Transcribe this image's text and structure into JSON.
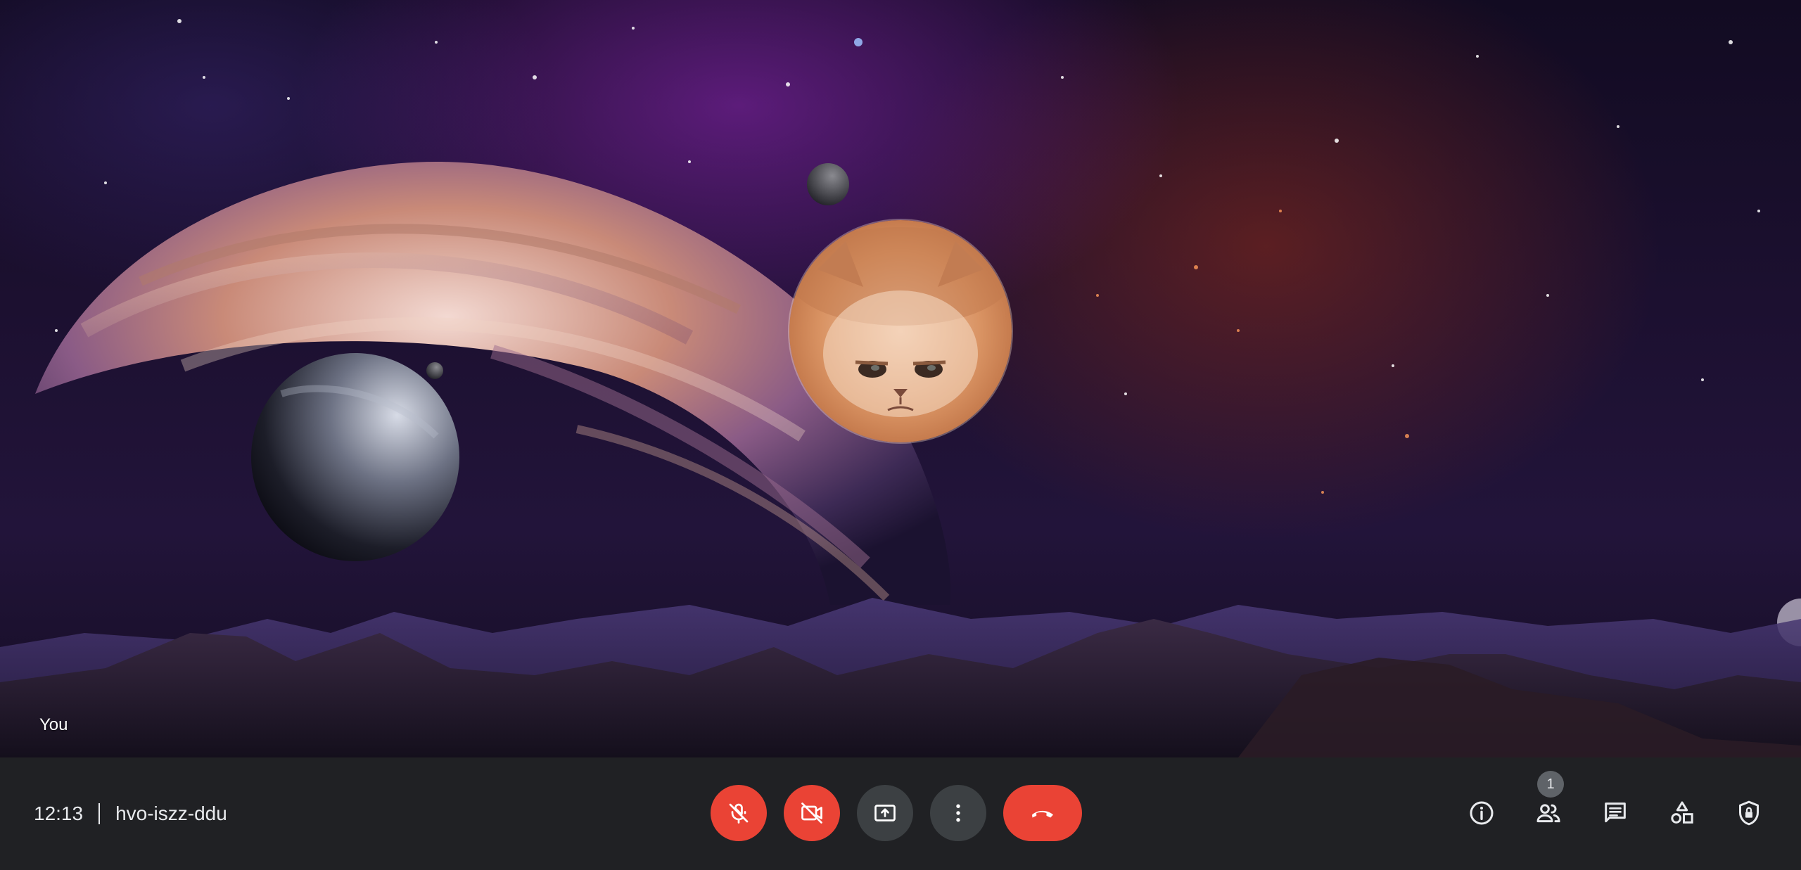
{
  "video_tile": {
    "participant_label": "You"
  },
  "bottom_bar": {
    "time": "12:13",
    "meeting_code": "hvo-iszz-ddu",
    "controls": {
      "mic": {
        "icon": "mic-off-icon",
        "state": "off",
        "color": "#ea4335"
      },
      "camera": {
        "icon": "videocam-off-icon",
        "state": "off",
        "color": "#ea4335"
      },
      "present": {
        "icon": "present-screen-icon",
        "color": "#3c4043"
      },
      "more": {
        "icon": "more-vert-icon",
        "color": "#3c4043"
      },
      "leave": {
        "icon": "call-end-icon",
        "color": "#ea4335"
      }
    },
    "side_panel": {
      "info_icon": "info-icon",
      "people_icon": "people-icon",
      "people_count": "1",
      "chat_icon": "chat-icon",
      "activities_icon": "activities-icon",
      "host_controls_icon": "shield-lock-icon"
    }
  }
}
